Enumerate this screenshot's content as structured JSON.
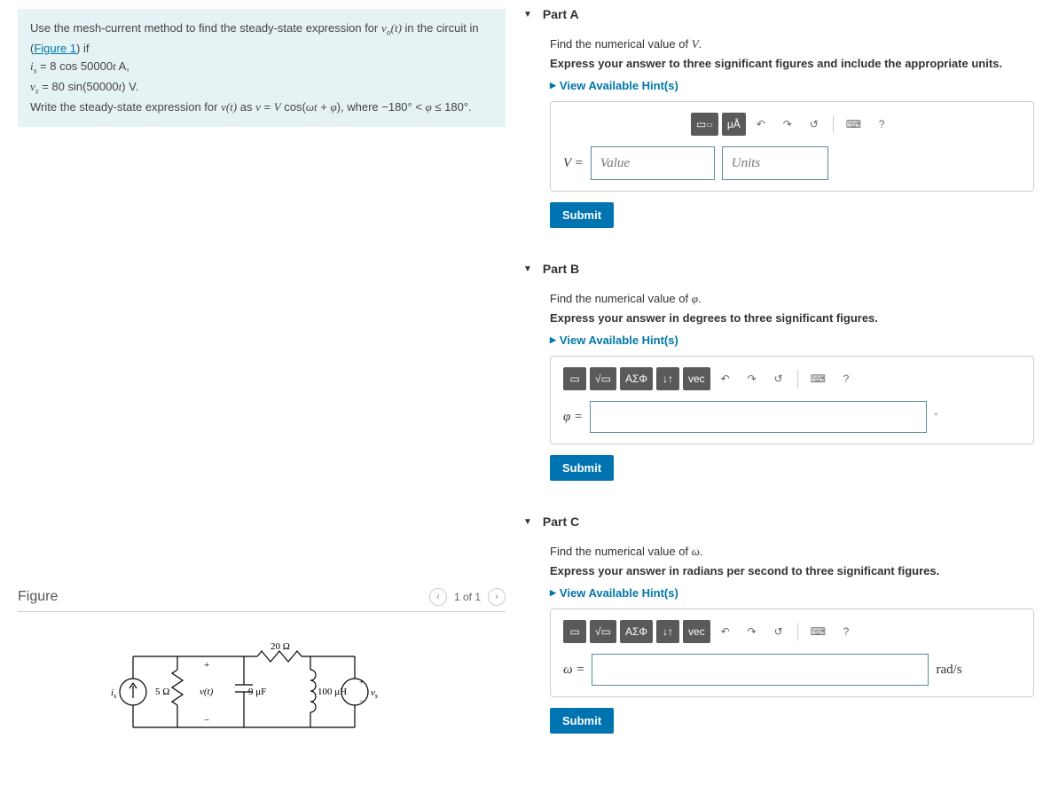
{
  "problem": {
    "intro_pre": "Use the mesh-current method to find the steady-state expression for ",
    "vo_t": "v_o(t)",
    "intro_post": " in the circuit in (",
    "figure_link": "Figure 1",
    "intro_close": ") if",
    "line_is": "i_s = 8 cos 50000t A,",
    "line_vs": "v_s = 80 sin(50000t) V.",
    "write_pre": "Write the steady-state expression for ",
    "v_t": "v(t)",
    "write_mid": " as ",
    "form": "v = V cos(ωt + φ)",
    "write_post": ", where ",
    "range": "−180° < φ ≤ 180°",
    "period": "."
  },
  "figure": {
    "title": "Figure",
    "nav_text": "1 of 1",
    "labels": {
      "r_top": "20 Ω",
      "r_left": "5 Ω",
      "cap": "9 μF",
      "ind": "100 μH",
      "is": "i_s",
      "vs": "v_s",
      "vt": "v(t)",
      "plus": "+",
      "minus": "−"
    }
  },
  "parts": {
    "a": {
      "title": "Part A",
      "instr": "Find the numerical value of V.",
      "bold": "Express your answer to three significant figures and include the appropriate units.",
      "hints": "View Available Hint(s)",
      "label": "V =",
      "value_ph": "Value",
      "units_ph": "Units",
      "tb_units": "μÅ",
      "submit": "Submit"
    },
    "b": {
      "title": "Part B",
      "instr": "Find the numerical value of φ.",
      "bold": "Express your answer in degrees to three significant figures.",
      "hints": "View Available Hint(s)",
      "label": "φ =",
      "suffix": "°",
      "tb_greek": "ΑΣΦ",
      "tb_vec": "vec",
      "submit": "Submit"
    },
    "c": {
      "title": "Part C",
      "instr": "Find the numerical value of ω.",
      "bold": "Express your answer in radians per second to three significant figures.",
      "hints": "View Available Hint(s)",
      "label": "ω =",
      "suffix": "rad/s",
      "tb_greek": "ΑΣΦ",
      "tb_vec": "vec",
      "submit": "Submit"
    }
  },
  "icons": {
    "undo": "↶",
    "redo": "↷",
    "reset": "↺",
    "keyboard": "⌨",
    "help": "?",
    "updown": "↓↑",
    "template": "▭",
    "sqrt": "√▭"
  }
}
